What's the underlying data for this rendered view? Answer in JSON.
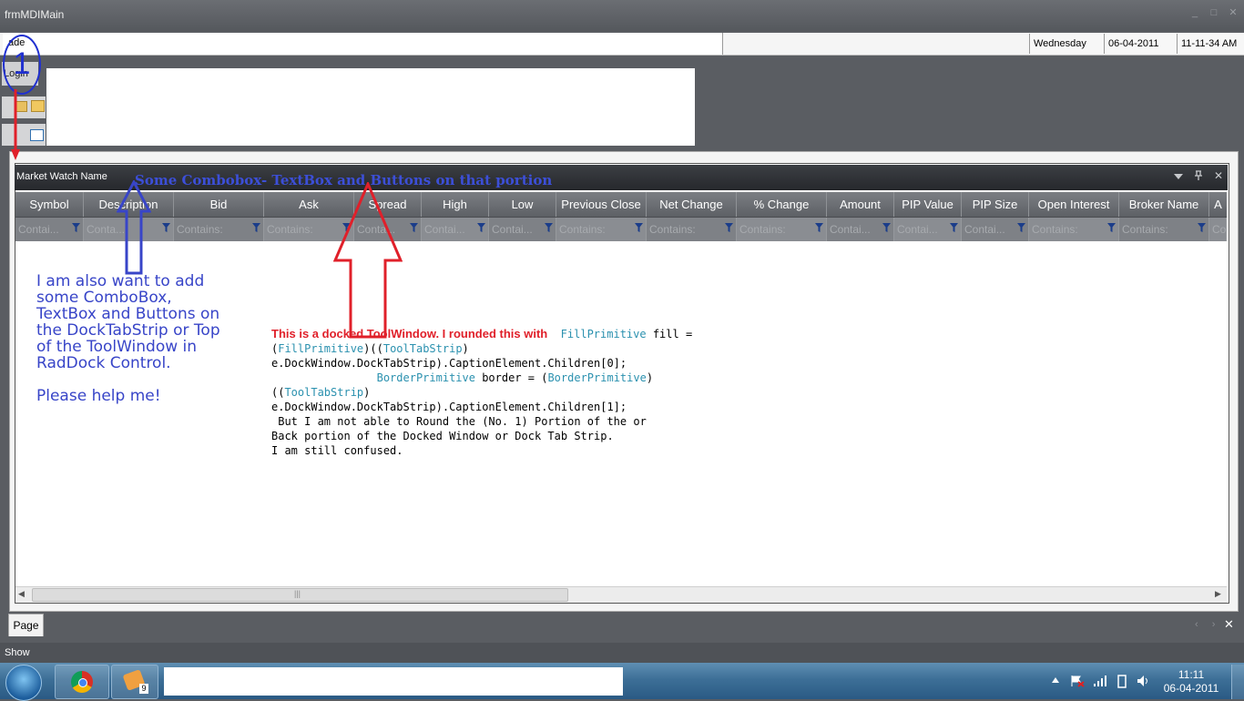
{
  "window": {
    "title": "frmMDIMain",
    "min": "_",
    "max": "□",
    "close": "✕"
  },
  "status": {
    "left_text": "ade",
    "day": "Wednesday",
    "date": "06-04-2011",
    "time": "11-11-34 AM"
  },
  "login": {
    "label": "Login"
  },
  "dock": {
    "caption": "Market Watch Name",
    "menu_icon": "chevron-down-icon",
    "pin_icon": "pin-icon",
    "close_label": "✕"
  },
  "grid": {
    "columns": [
      "Symbol",
      "Description",
      "Bid",
      "Ask",
      "Spread",
      "High",
      "Low",
      "Previous Close",
      "Net Change",
      "% Change",
      "Amount",
      "PIP Value",
      "PIP Size",
      "Open Interest",
      "Broker Name",
      "A"
    ],
    "filters": [
      "Contai...",
      "Conta...",
      "Contains:",
      "Contains:",
      "Conta...",
      "Contai...",
      "Contai...",
      "Contains:",
      "Contains:",
      "Contains:",
      "Contai...",
      "Contai...",
      "Contai...",
      "Contains:",
      "Contains:",
      "Co"
    ]
  },
  "annotations": {
    "number": "1",
    "caption_note": "Some Combobox- TextBox and Buttons on that portion",
    "left_note_1": "I am also want to add",
    "left_note_2": "some ComboBox,",
    "left_note_3": "TextBox and Buttons on",
    "left_note_4": "the DockTabStrip or Top",
    "left_note_5": "of the ToolWindow in",
    "left_note_6": "RadDock Control.",
    "left_note_7": "Please help me!",
    "code_red": "This is a docked ToolWindow. I rounded this with",
    "code_1a": "FillPrimitive",
    "code_1b": " fill =",
    "code_2a": "(",
    "code_2b": "FillPrimitive",
    "code_2c": ")((",
    "code_2d": "ToolTabStrip",
    "code_2e": ")",
    "code_3": "e.DockWindow.DockTabStrip).CaptionElement.Children[0];",
    "code_4a": "BorderPrimitive",
    "code_4b": " border = (",
    "code_4c": "BorderPrimitive",
    "code_4d": ")",
    "code_5a": "((",
    "code_5b": "ToolTabStrip",
    "code_5c": ")",
    "code_6": "e.DockWindow.DockTabStrip).CaptionElement.Children[1];",
    "code_7": " But I am not able to Round the (No. 1) Portion of the or",
    "code_8": "Back portion of the Docked Window or Dock Tab Strip.",
    "code_9": "I am still confused."
  },
  "tabs": {
    "page_label": "Page",
    "nav": "‹ ›",
    "close": "✕"
  },
  "showbar": {
    "label": "Show"
  },
  "taskbar": {
    "clock_time": "11:11",
    "clock_date": "06-04-2011",
    "badge": "9"
  },
  "colors": {
    "accent_blue": "#3845c8",
    "accent_red": "#e0202a",
    "header_bg": "#6b6e73",
    "caption_bg": "#2c2e32"
  }
}
